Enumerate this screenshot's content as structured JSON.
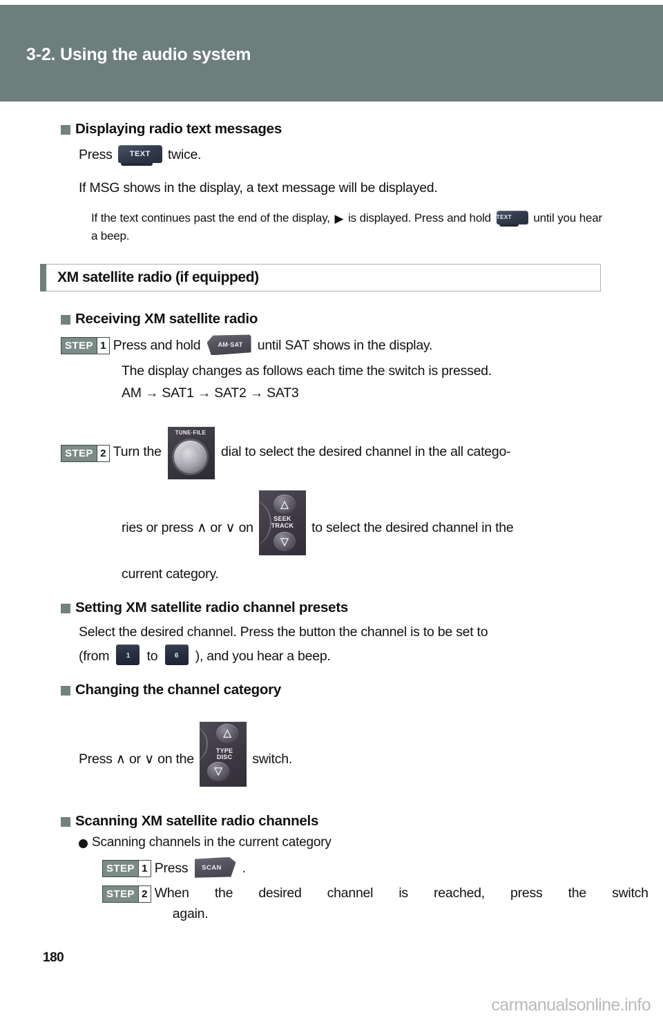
{
  "header": {
    "chapter_title": "3-2. Using the audio system",
    "band_color": "#6d7e7c"
  },
  "page": {
    "number": "180",
    "watermark": "carmanualsonline.info"
  },
  "sections": [
    {
      "id": "radio-text",
      "heading": "Displaying radio text messages",
      "line1_pre": "Press",
      "line1_post": "twice.",
      "line2": "If MSG shows in the display, a text message will be displayed.",
      "note_pre": "If the text continues past the end of the display,",
      "note_mid": "is displayed. Press and hold",
      "note_post": "until you hear a beep.",
      "buttons": {
        "text_label": "TEXT",
        "arrow_glyph": "▶"
      }
    },
    {
      "id": "xm-satellite-radio",
      "box_title": "XM satellite radio (if equipped)"
    },
    {
      "id": "receiving-xm",
      "heading": "Receiving XM satellite radio",
      "step1": {
        "step_word": "STEP",
        "step_number": "1",
        "text_pre": "Press and hold",
        "text_post": "until SAT shows in the display.",
        "button_label": "AM·SAT"
      },
      "sub_line1": "The display changes as follows each time the switch is pressed.",
      "sub_line2": "AM → SAT1 → SAT2 → SAT3",
      "step2": {
        "step_word": "STEP",
        "step_number": "2",
        "text_a": "Turn the",
        "text_b": "dial to select the desired channel in the all catego-",
        "text_c": "ries or press ∧ or ∨ on",
        "text_d": "to select the desired channel in the",
        "text_e": "current category.",
        "dial_label": "TUNE·FILE",
        "rocker_label_line1": "SEEK",
        "rocker_label_line2": "TRACK"
      }
    },
    {
      "id": "setting-presets",
      "heading": "Setting XM satellite radio channel presets",
      "line1": "Select the desired channel. Press the button the channel is to be set to",
      "line2_pre": "(from",
      "line2_mid": "to",
      "line2_post": "), and you hear a beep.",
      "preset_from": "1",
      "preset_to": "6"
    },
    {
      "id": "changing-category",
      "heading": "Changing the channel category",
      "line_pre": "Press ∧ or ∨ on the",
      "line_post": "switch.",
      "rocker_label_line1": "TYPE",
      "rocker_label_line2": "DISC"
    },
    {
      "id": "scanning-channels",
      "heading": "Scanning XM satellite radio channels",
      "sub_heading": "Scanning channels in the current category",
      "step1": {
        "step_word": "STEP",
        "step_number": "1",
        "text_pre": "Press",
        "text_post": ".",
        "button_label": "SCAN"
      },
      "step2": {
        "step_word": "STEP",
        "step_number": "2",
        "text_line1": "When the desired channel is reached, press the switch",
        "text_line2": "again."
      }
    }
  ],
  "icons": {
    "chevron_up": "∧",
    "chevron_down": "∨",
    "rocker_up": "⌃",
    "rocker_down": "⌄"
  }
}
